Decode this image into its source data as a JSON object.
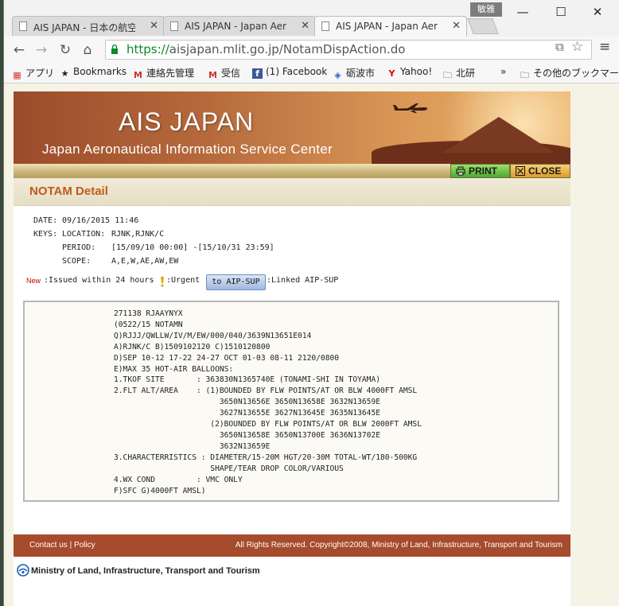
{
  "browser": {
    "profile_name": "敏雅",
    "tabs": [
      {
        "title": "AIS JAPAN - 日本の航空情"
      },
      {
        "title": "AIS JAPAN - Japan Aeronau"
      },
      {
        "title": "AIS JAPAN - Japan Aeronau"
      }
    ],
    "url_scheme": "https://",
    "url_host": "aisjapan.mlit.go.jp",
    "url_path": "/NotamDispAction.do",
    "bookmarks": [
      "アプリ",
      "Bookmarks",
      "連絡先管理",
      "受信",
      "(1) Facebook",
      "砺波市",
      "Yahoo!",
      "北研",
      "»",
      "その他のブックマーク"
    ]
  },
  "site": {
    "brand": "AIS JAPAN",
    "subtitle": "Japan Aeronautical Information Service Center",
    "print_label": "PRINT",
    "close_label": "CLOSE",
    "section_title": "NOTAM Detail"
  },
  "meta": {
    "date_label": "DATE:",
    "date_value": "09/16/2015 11:46",
    "keys_label": "KEYS:",
    "location_label": "LOCATION:",
    "location_value": "RJNK,RJNK/C",
    "period_label": "PERIOD:",
    "period_value": "[15/09/10 00:00] -[15/10/31 23:59]",
    "scope_label": "SCOPE:",
    "scope_value": "A,E,W,AE,AW,EW"
  },
  "legend": {
    "new_tag": "New",
    "new_text": ":Issued within 24 hours",
    "urgent_text": ":Urgent",
    "aip_button": "to AIP-SUP",
    "aip_text": ":Linked AIP-SUP"
  },
  "notam_text": "271138 RJAAYNYX\n(0522/15 NOTAMN\nQ)RJJJ/QWLLW/IV/M/EW/000/040/3639N13651E014\nA)RJNK/C B)1509102120 C)1510120800\nD)SEP 10-12 17-22 24-27 OCT 01-03 08-11 2120/0800\nE)MAX 35 HOT-AIR BALLOONS:\n1.TKOF SITE       : 363830N1365740E (TONAMI-SHI IN TOYAMA)\n2.FLT ALT/AREA    : (1)BOUNDED BY FLW POINTS/AT OR BLW 4000FT AMSL\n                       3650N13656E 3650N13658E 3632N13659E\n                       3627N13655E 3627N13645E 3635N13645E\n                     (2)BOUNDED BY FLW POINTS/AT OR BLW 2000FT AMSL\n                       3650N13658E 3650N13700E 3636N13702E\n                       3632N13659E\n3.CHARACTERRISTICS : DIAMETER/15-20M HGT/20-30M TOTAL-WT/180-500KG\n                     SHAPE/TEAR DROP COLOR/VARIOUS\n4.WX COND         : VMC ONLY\nF)SFC G)4000FT AMSL)",
  "footer": {
    "contact": "Contact us",
    "separator": "|",
    "policy": "Policy",
    "copyright": "All Rights Reserved. Copyright©2008, Ministry of Land, Infrastructure, Transport and Tourism",
    "ministry": "Ministry of Land, Infrastructure, Transport and Tourism"
  }
}
